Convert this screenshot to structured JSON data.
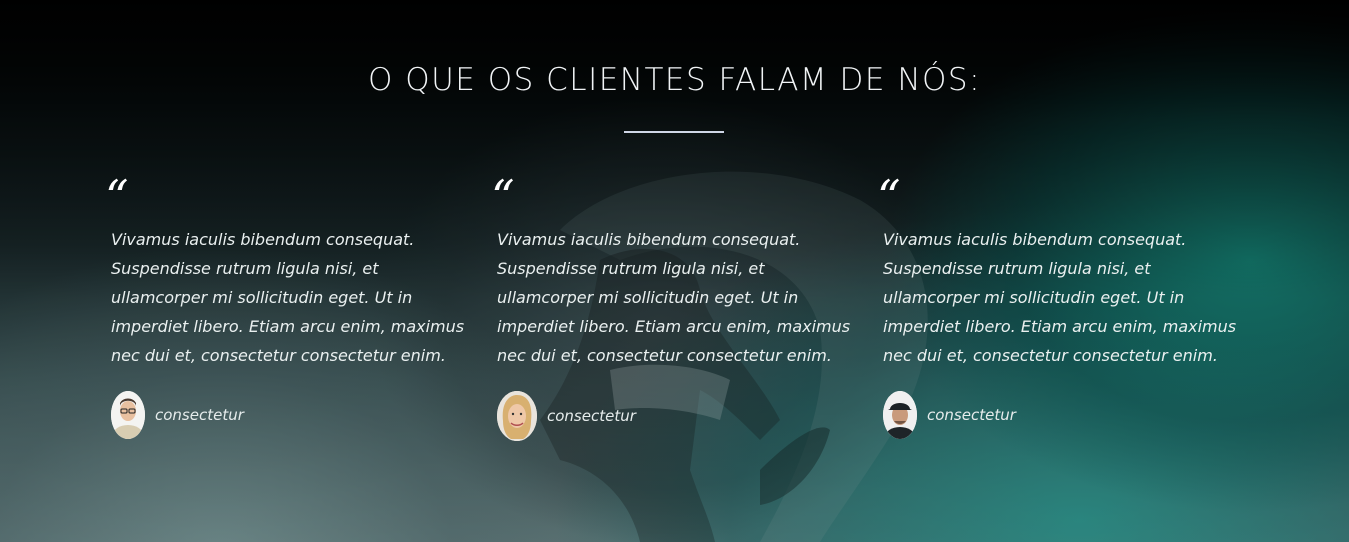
{
  "section": {
    "title": "O QUE OS CLIENTES FALAM DE NÓS:"
  },
  "testimonials": [
    {
      "quote_mark": "“",
      "text": "Vivamus iaculis bibendum consequat. Suspendisse rutrum ligula nisi, et ullamcorper mi sollicitudin eget. Ut in imperdiet libero. Etiam arcu enim, maximus nec dui et, consectetur consectetur enim.",
      "author": "consectetur",
      "avatar_icon": "man-with-glasses-avatar"
    },
    {
      "quote_mark": "“",
      "text": "Vivamus iaculis bibendum consequat. Suspendisse rutrum ligula nisi, et ullamcorper mi sollicitudin eget. Ut in imperdiet libero. Etiam arcu enim, maximus nec dui et, consectetur consectetur enim.",
      "author": "consectetur",
      "avatar_icon": "blonde-woman-avatar"
    },
    {
      "quote_mark": "“",
      "text": "Vivamus iaculis bibendum consequat. Suspendisse rutrum ligula nisi, et ullamcorper mi sollicitudin eget. Ut in imperdiet libero. Etiam arcu enim, maximus nec dui et, consectetur consectetur enim.",
      "author": "consectetur",
      "avatar_icon": "man-with-cap-avatar"
    }
  ],
  "colors": {
    "text": "#eef2f3",
    "divider": "#cfd6e6",
    "wave_teal": "#148c7d"
  }
}
